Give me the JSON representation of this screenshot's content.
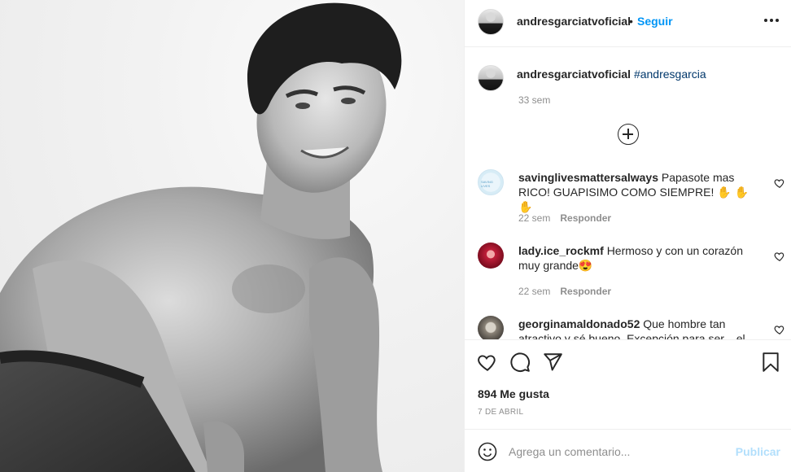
{
  "post": {
    "username": "andresgarciatvoficial",
    "separator": "•",
    "follow_label": "Seguir",
    "more_icon": "more-horizontal-icon"
  },
  "caption": {
    "username": "andresgarciatvoficial",
    "hashtag": "#andresgarcia",
    "time": "33 sem"
  },
  "comments": [
    {
      "username": "savinglivesmattersalways",
      "text": "Papasote mas RICO! GUAPISIMO COMO SIEMPRE! ✋ ✋ ✋",
      "time": "22 sem",
      "reply_label": "Responder"
    },
    {
      "username": "lady.ice_rockmf",
      "text": "Hermoso y con un corazón muy grande😍",
      "time": "22 sem",
      "reply_label": "Responder"
    },
    {
      "username": "georginamaldonado52",
      "text": "Que hombre tan atractivo y sé bueno, Excepción para ser... el mejor",
      "time": "",
      "reply_label": ""
    }
  ],
  "actions": {
    "likes": "894 Me gusta",
    "date": "7 DE ABRIL"
  },
  "add_comment": {
    "placeholder": "Agrega un comentario...",
    "publish_label": "Publicar"
  },
  "colors": {
    "accent": "#0095f6",
    "hashtag": "#00376b",
    "muted": "#8e8e8e",
    "publish_disabled": "#b2dffc"
  }
}
